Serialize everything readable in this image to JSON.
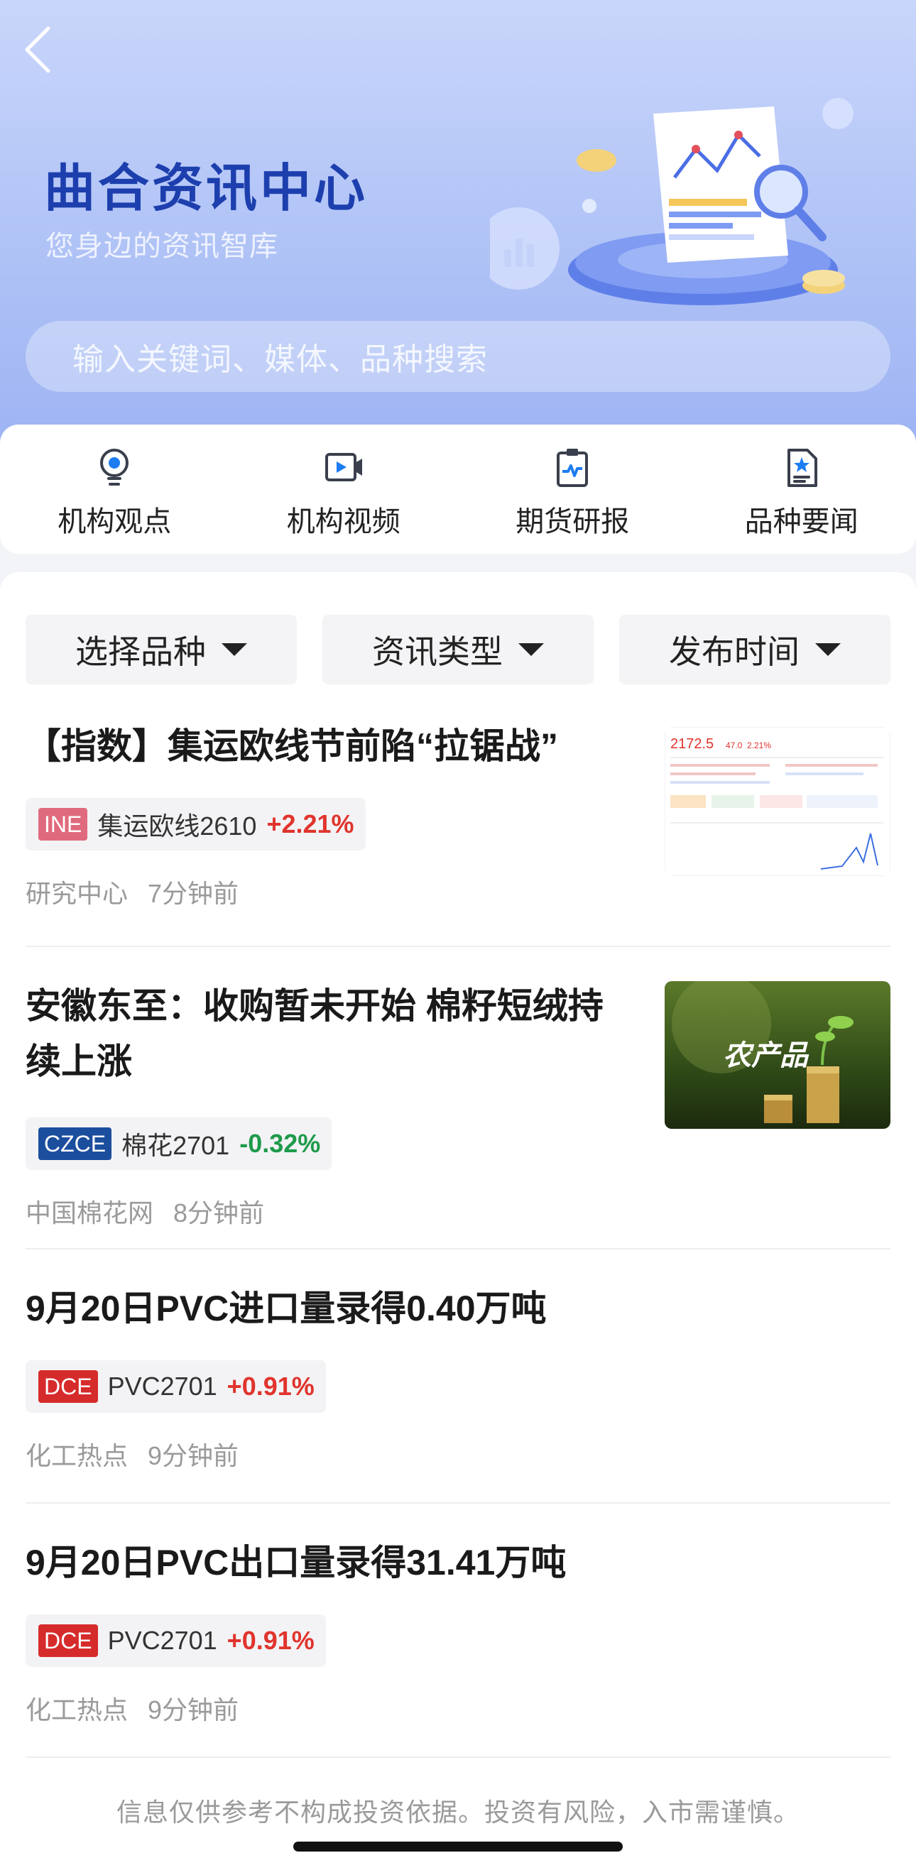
{
  "hero": {
    "title": "曲合资讯中心",
    "subtitle": "您身边的资讯智库",
    "search_placeholder": "输入关键词、媒体、品种搜索"
  },
  "quick_nav": [
    {
      "label": "机构观点",
      "icon": "lightbulb-icon"
    },
    {
      "label": "机构视频",
      "icon": "video-icon"
    },
    {
      "label": "期货研报",
      "icon": "report-clipboard-icon"
    },
    {
      "label": "品种要闻",
      "icon": "news-star-icon"
    }
  ],
  "filters": [
    {
      "label": "选择品种"
    },
    {
      "label": "资讯类型"
    },
    {
      "label": "发布时间"
    }
  ],
  "articles": [
    {
      "title": "【指数】集运欧线节前陷“拉锯战”",
      "exchange": "INE",
      "contract": "集运欧线2610",
      "change": "+2.21%",
      "source": "研究中心",
      "time": "7分钟前",
      "thumb": {
        "price": "2172.5",
        "delta": "47.0",
        "pct": "2.21%"
      }
    },
    {
      "title": "安徽东至：收购暂未开始  棉籽短绒持续上涨",
      "exchange": "CZCE",
      "contract": "棉花2701",
      "change": "-0.32%",
      "source": "中国棉花网",
      "time": "8分钟前",
      "thumb": {
        "label": "农产品"
      }
    },
    {
      "title": "9月20日PVC进口量录得0.40万吨",
      "exchange": "DCE",
      "contract": "PVC2701",
      "change": "+0.91%",
      "source": "化工热点",
      "time": "9分钟前"
    },
    {
      "title": "9月20日PVC出口量录得31.41万吨",
      "exchange": "DCE",
      "contract": "PVC2701",
      "change": "+0.91%",
      "source": "化工热点",
      "time": "9分钟前"
    }
  ],
  "disclaimer": "信息仅供参考不构成投资依据。投资有风险，入市需谨慎。",
  "colors": {
    "brand_blue": "#1d3fae",
    "up": "#e0342d",
    "down": "#1e9a4b"
  }
}
